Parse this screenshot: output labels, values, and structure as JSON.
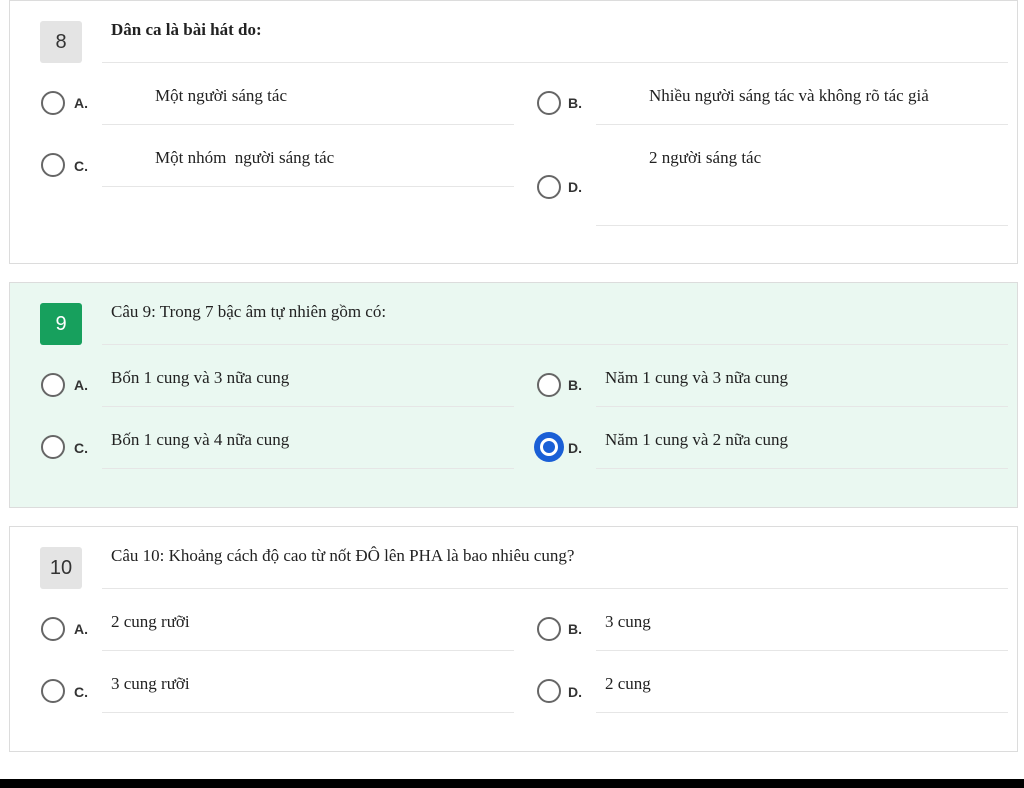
{
  "questions": [
    {
      "number": "8",
      "text": "Dân ca là bài hát do:",
      "options": [
        {
          "letter": "A.",
          "text": "Một người sáng tác"
        },
        {
          "letter": "B.",
          "text": "Nhiều người sáng tác và không rõ tác giả"
        },
        {
          "letter": "C.",
          "text": "Một nhóm  người sáng tác"
        },
        {
          "letter": "D.",
          "text": "2 người sáng tác"
        }
      ],
      "selected": null
    },
    {
      "number": "9",
      "text": "Câu 9: Trong 7 bậc âm tự nhiên gồm có:",
      "options": [
        {
          "letter": "A.",
          "text": "Bốn 1 cung và 3 nữa cung"
        },
        {
          "letter": "B.",
          "text": "Năm 1 cung và 3 nữa cung"
        },
        {
          "letter": "C.",
          "text": "Bốn 1 cung và 4 nữa cung"
        },
        {
          "letter": "D.",
          "text": "Năm 1 cung và 2 nữa cung"
        }
      ],
      "selected": "D."
    },
    {
      "number": "10",
      "text": "Câu 10: Khoảng cách độ cao từ nốt ĐÔ lên PHA là bao nhiêu cung?",
      "options": [
        {
          "letter": "A.",
          "text": "2 cung rưỡi"
        },
        {
          "letter": "B.",
          "text": "3 cung"
        },
        {
          "letter": "C.",
          "text": "3 cung rưỡi"
        },
        {
          "letter": "D.",
          "text": "2 cung"
        }
      ],
      "selected": null
    }
  ],
  "colors": {
    "active_background": "#eaf8f1",
    "active_number_badge": "#17a05d",
    "selected_radio": "#1a5fd6"
  }
}
